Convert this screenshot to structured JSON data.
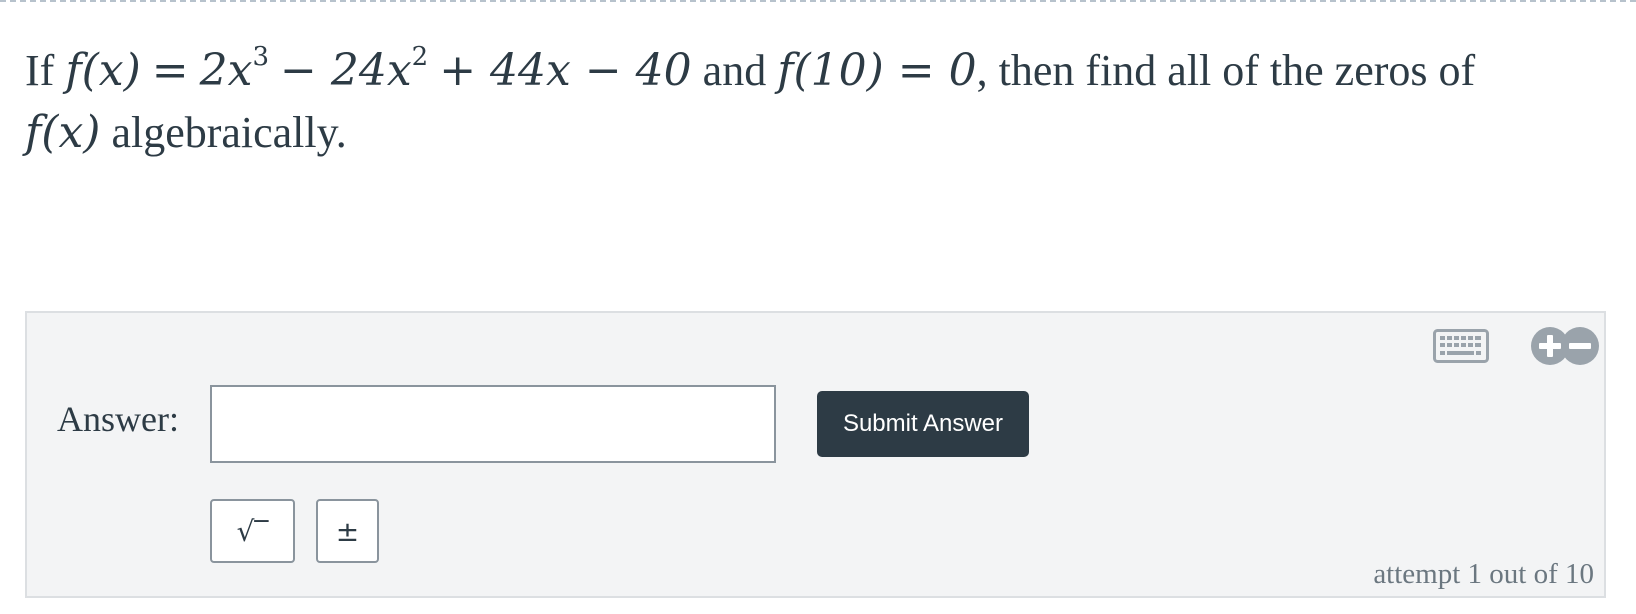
{
  "question": {
    "prefix": "If",
    "f_of_x": "f(x)",
    "equals": "=",
    "polynomial_head": "2x",
    "exp3": "3",
    "minus_24x": "− 24x",
    "exp2": "2",
    "polynomial_tail": "+ 44x − 40",
    "and": "and",
    "f_of_10": "f(10) = 0",
    "middle": ", then find all of the zeros of",
    "f_of_x_2": "f(x)",
    "suffix": "algebraically."
  },
  "answer": {
    "label": "Answer:",
    "input_value": "",
    "input_placeholder": "",
    "submit_label": "Submit Answer",
    "sqrt_key": "√‾",
    "plusminus_key": "±",
    "attempt_text": "attempt 1 out of 10"
  },
  "icons": {
    "keyboard": "keyboard-icon",
    "zoom_in": "plus-circle-icon",
    "zoom_out": "minus-circle-icon"
  },
  "colors": {
    "text": "#2d3b45",
    "button_bg": "#2d3b45",
    "panel_bg": "#f3f4f5",
    "icon": "#9aa3ab"
  }
}
